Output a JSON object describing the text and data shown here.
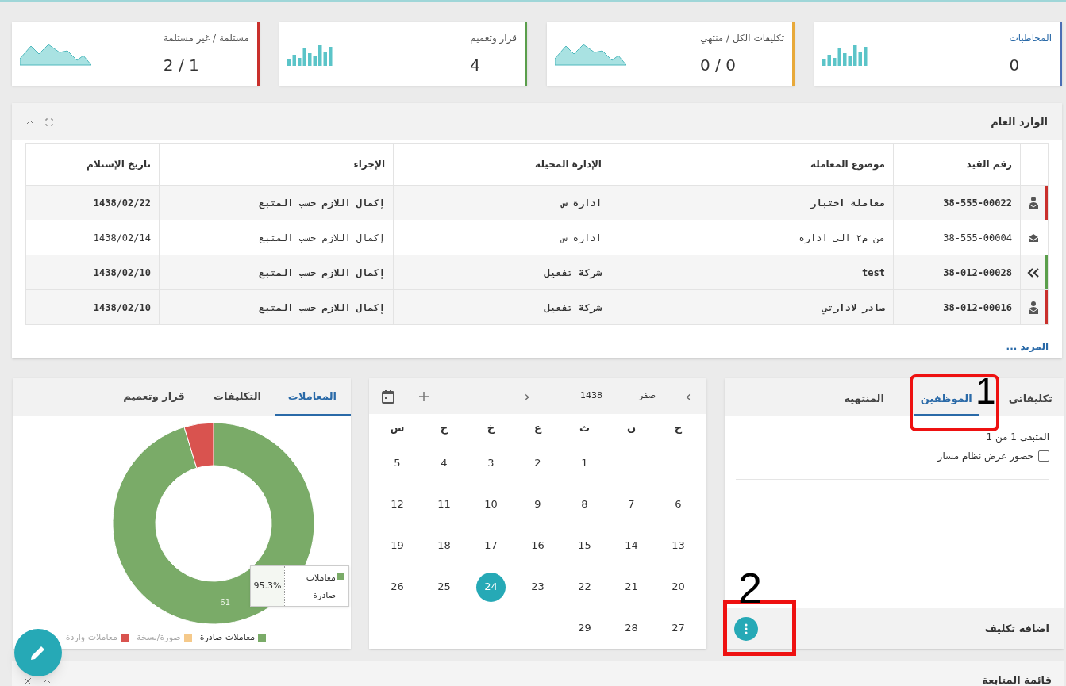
{
  "stats": [
    {
      "label": "المخاطبات",
      "value": "0",
      "color": "#4a6fb5",
      "kind": "bars",
      "link": true
    },
    {
      "label": "تكليفات الكل / منتهي",
      "value": "0 / 0",
      "color": "#e8a93a",
      "kind": "area",
      "link": false
    },
    {
      "label": "قرار وتعميم",
      "value": "4",
      "color": "#5a9e4b",
      "kind": "bars",
      "link": false
    },
    {
      "label": "مستلمة / غير مستلمة",
      "value": "2 / 1",
      "color": "#c9302c",
      "kind": "area",
      "link": false
    }
  ],
  "inbox": {
    "title": "الوارد العام",
    "columns": [
      "رقم القيد",
      "موضوع المعاملة",
      "الإدارة المحيلة",
      "الإجراء",
      "تاريخ الإستلام"
    ],
    "rows": [
      {
        "kind": "mail",
        "color": "#c9302c",
        "unread": true,
        "cells": [
          "38-555-00022",
          "معاملة اختبار",
          "ادارة س",
          "إكمال اللازم حسب المتبع",
          "1438/02/22"
        ]
      },
      {
        "kind": "envelope",
        "unread": false,
        "cells": [
          "38-555-00004",
          "من م٢ الي ادارة",
          "ادارة س",
          "إكمال اللازم حسب المتبع",
          "1438/02/14"
        ]
      },
      {
        "kind": "chevron",
        "color": "#5a9e4b",
        "unread": true,
        "cells": [
          "38-012-00028",
          "test",
          "شركة تفعيل",
          "إكمال اللازم حسب المتبع",
          "1438/02/10"
        ]
      },
      {
        "kind": "mail",
        "color": "#c9302c",
        "unread": true,
        "cells": [
          "38-012-00016",
          "صادر لادارتي",
          "شركة تفعيل",
          "إكمال اللازم حسب المتبع",
          "1438/02/10"
        ]
      }
    ],
    "more": "المزيد ..."
  },
  "assignments": {
    "tabs": [
      {
        "label": "تكليفاتى",
        "selected": false
      },
      {
        "label": "الموظفين",
        "selected": true,
        "annotation": "1"
      },
      {
        "label": "المنتهية",
        "selected": false
      }
    ],
    "remaining": "المتبقى 1 من 1",
    "checkbox": {
      "label": "حضور عرض نظام مسار",
      "checked": false
    },
    "footer": "اضافة تكليف",
    "menu_annotation": "2"
  },
  "calendar": {
    "next": "›",
    "month": "صفر",
    "year": "1438",
    "previous": "‹",
    "weekdays": [
      "ح",
      "ن",
      "ث",
      "ع",
      "خ",
      "ج",
      "س"
    ],
    "weeks": [
      {
        "kind": "first",
        "days": [
          {
            "day": "1",
            "selected": false
          },
          {
            "day": "2",
            "selected": false
          },
          {
            "day": "3",
            "selected": false
          },
          {
            "day": "4",
            "selected": false
          },
          {
            "day": "5",
            "selected": false
          }
        ]
      },
      {
        "kind": "full",
        "days": [
          {
            "day": "6",
            "selected": false
          },
          {
            "day": "7",
            "selected": false
          },
          {
            "day": "8",
            "selected": false
          },
          {
            "day": "9",
            "selected": false
          },
          {
            "day": "10",
            "selected": false
          },
          {
            "day": "11",
            "selected": false
          },
          {
            "day": "12",
            "selected": false
          }
        ]
      },
      {
        "kind": "full",
        "days": [
          {
            "day": "13",
            "selected": false
          },
          {
            "day": "14",
            "selected": false
          },
          {
            "day": "15",
            "selected": false
          },
          {
            "day": "16",
            "selected": false
          },
          {
            "day": "17",
            "selected": false
          },
          {
            "day": "18",
            "selected": false
          },
          {
            "day": "19",
            "selected": false
          }
        ]
      },
      {
        "kind": "full",
        "days": [
          {
            "day": "20",
            "selected": false
          },
          {
            "day": "21",
            "selected": false
          },
          {
            "day": "22",
            "selected": false
          },
          {
            "day": "23",
            "selected": false
          },
          {
            "day": "24",
            "selected": true
          },
          {
            "day": "25",
            "selected": false
          },
          {
            "day": "26",
            "selected": false
          }
        ]
      },
      {
        "kind": "last",
        "days": [
          {
            "day": "27",
            "selected": false
          },
          {
            "day": "28",
            "selected": false
          },
          {
            "day": "29",
            "selected": false
          }
        ]
      }
    ]
  },
  "stats_panel": {
    "tabs": [
      {
        "label": "المعاملات",
        "selected": true
      },
      {
        "label": "التكليفات",
        "selected": false
      },
      {
        "label": "قرار وتعميم",
        "selected": false
      }
    ],
    "chart_data": {
      "type": "donut",
      "categories": [
        "معاملات صادرة",
        "صورة/نسخة",
        "معاملات واردة"
      ],
      "values": [
        95.3,
        null,
        4.7
      ],
      "annotations": [
        {
          "text": "61"
        }
      ]
    },
    "legend": [
      {
        "color": "#7aab68",
        "faded": false
      },
      {
        "color": "#f5c98a",
        "faded": true
      },
      {
        "color": "#d9534f",
        "faded": true
      }
    ],
    "tooltip": {
      "label": "معاملات صادرة",
      "value": "95.3%",
      "color": "#7aab68"
    }
  },
  "followup": {
    "title": "قائمة المتابعة"
  }
}
